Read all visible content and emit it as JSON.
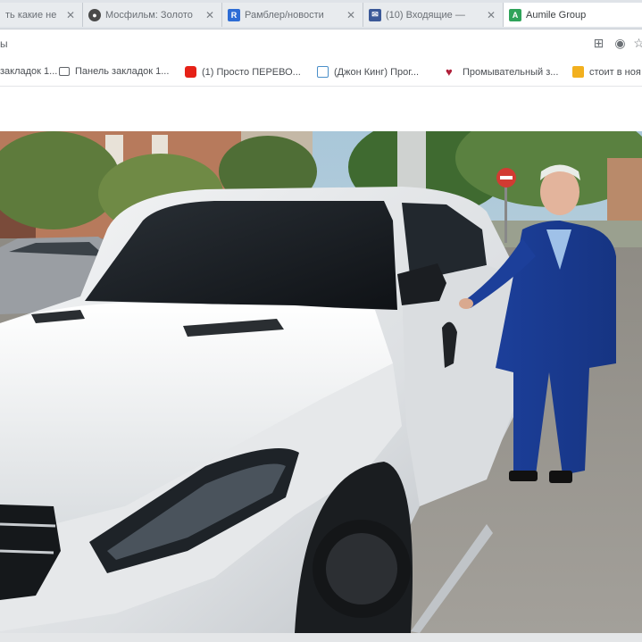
{
  "tabs": [
    {
      "title": "ть какие не",
      "favicon": "generic"
    },
    {
      "title": "Мосфильм: Золото",
      "favicon": "mosfilm-icon"
    },
    {
      "title": "Рамблер/новости",
      "favicon": "rambler-icon"
    },
    {
      "title": "(10) Входящие —",
      "favicon": "mail-icon"
    },
    {
      "title": "Aumile Group",
      "favicon": "aumile-icon"
    }
  ],
  "toolbar": {
    "url_fragment": "ы"
  },
  "bookmarks": [
    {
      "label": "закладок 1...",
      "icon": "folder-icon"
    },
    {
      "label": "Панель закладок 1...",
      "icon": "folder-icon"
    },
    {
      "label": "(1) Просто ПЕРЕВО...",
      "icon": "youtube-icon"
    },
    {
      "label": "(Джон Кинг) Прог...",
      "icon": "page-icon"
    },
    {
      "label": "Промывательный з...",
      "icon": "heart-icon"
    },
    {
      "label": "стоит в ноя",
      "icon": "bookmark-icon"
    }
  ],
  "colors": {
    "tab_strip": "#dfe3e8",
    "youtube_red": "#e62117",
    "rambler_blue": "#2d6cd5",
    "mail_blue": "#3b5998",
    "aumile_green": "#2fa35a"
  }
}
